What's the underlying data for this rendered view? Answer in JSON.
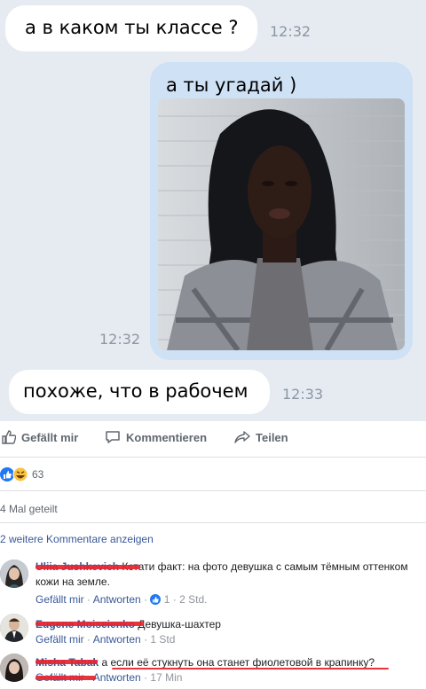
{
  "chat": {
    "msg1": {
      "text": "а в каком ты классе ?",
      "time": "12:32"
    },
    "msg2": {
      "text": "а ты угадай )",
      "time": "12:32"
    },
    "msg3": {
      "text": "похоже, что в рабочем",
      "time": "12:33"
    }
  },
  "actions": {
    "like": "Gefällt mir",
    "comment": "Kommentieren",
    "share": "Teilen"
  },
  "reactions": {
    "count": "63"
  },
  "shares": "4 Mal geteilt",
  "more_comments": "2 weitere Kommentare anzeigen",
  "comments": [
    {
      "name": "Uliia Jushkevich",
      "text": "Кстати факт: на фото девушка с самым тёмным оттенком кожи на земле.",
      "like": "Gefällt mir",
      "reply": "Antworten",
      "likes": "1",
      "age": "2 Std."
    },
    {
      "name": "Eugene Moiseienko",
      "text": "Девушка-шахтер",
      "like": "Gefällt mir",
      "reply": "Antworten",
      "age": "1 Std"
    },
    {
      "name": "Misha Tabak",
      "text": "а если её стукнуть она станет фиолетовой в крапинку?",
      "like": "Gefällt mir",
      "reply": "Antworten",
      "age": "17 Min"
    }
  ],
  "colors": {
    "chat_bg": "#e6ebf1",
    "outgoing": "#cfe1f5",
    "link": "#385898",
    "redact": "#e5232e"
  }
}
